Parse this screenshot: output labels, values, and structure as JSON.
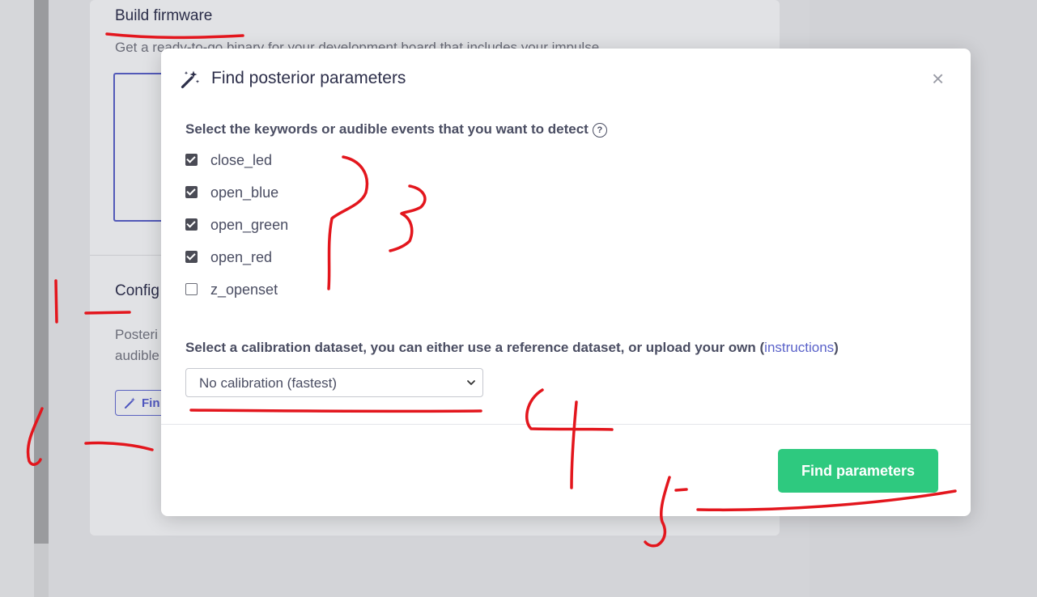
{
  "background": {
    "build_title": "Build firmware",
    "build_desc": "Get a ready-to-go binary for your development board that includes your impulse.",
    "config_title": "Config",
    "posterior_text_1": "Posteri",
    "posterior_text_2": "audible",
    "find_button_label": "Fin"
  },
  "modal": {
    "title": "Find posterior parameters",
    "close_symbol": "×",
    "keywords_label": "Select the keywords or audible events that you want to detect",
    "help_symbol": "?",
    "keywords": [
      {
        "label": "close_led",
        "checked": true
      },
      {
        "label": "open_blue",
        "checked": true
      },
      {
        "label": "open_green",
        "checked": true
      },
      {
        "label": "open_red",
        "checked": true
      },
      {
        "label": "z_openset",
        "checked": false
      }
    ],
    "calibration_label_prefix": "Select a calibration dataset, you can either use a reference dataset, or upload your own (",
    "calibration_link": "instructions",
    "calibration_label_suffix": ")",
    "calibration_selected": "No calibration (fastest)",
    "find_button_label": "Find parameters"
  },
  "annotations": {
    "color": "#e3161d",
    "marks": [
      "1",
      "2",
      "3",
      "4",
      "5"
    ]
  },
  "colors": {
    "primary_button": "#2ec97f",
    "link": "#5a62c9",
    "accent_outline": "#5259b8"
  },
  "icons": [
    "wand-icon",
    "close-icon",
    "help-icon",
    "chevron-down-icon",
    "checkbox"
  ]
}
